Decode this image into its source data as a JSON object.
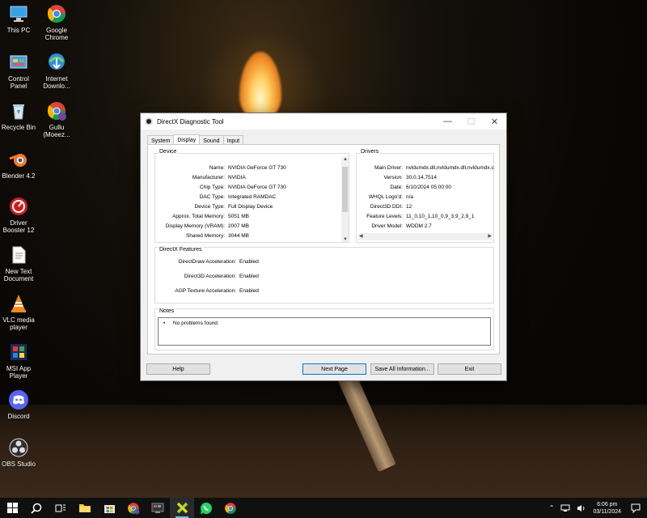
{
  "desktop": {
    "icons": [
      {
        "label": "This PC",
        "icon": "this-pc-icon"
      },
      {
        "label": "Google\nChrome",
        "icon": "chrome-icon"
      },
      {
        "label": "Control\nPanel",
        "icon": "control-panel-icon"
      },
      {
        "label": "Internet\nDownlo...",
        "icon": "idm-icon"
      },
      {
        "label": "Recycle Bin",
        "icon": "recycle-bin-icon"
      },
      {
        "label": "Gullu\n(Moeez...",
        "icon": "chrome-profile-icon"
      },
      {
        "label": "Blender 4.2",
        "icon": "blender-icon"
      },
      {
        "label": "Driver\nBooster 12",
        "icon": "driver-booster-icon"
      },
      {
        "label": "New Text\nDocument",
        "icon": "text-document-icon"
      },
      {
        "label": "VLC media\nplayer",
        "icon": "vlc-icon"
      },
      {
        "label": "MSI App\nPlayer",
        "icon": "msi-app-player-icon"
      },
      {
        "label": "Discord",
        "icon": "discord-icon"
      },
      {
        "label": "OBS Studio",
        "icon": "obs-icon"
      }
    ]
  },
  "window": {
    "title": "DirectX Diagnostic Tool",
    "controls": {
      "minimize": "—",
      "maximize": "☐",
      "close": "✕"
    },
    "tabs": [
      "System",
      "Display",
      "Sound",
      "Input"
    ],
    "active_tab": "Display",
    "device": {
      "title": "Device",
      "rows": [
        {
          "k": "Name:",
          "v": "NVIDIA GeForce GT 730"
        },
        {
          "k": "Manufacturer:",
          "v": "NVIDIA"
        },
        {
          "k": "Chip Type:",
          "v": "NVIDIA GeForce GT 730"
        },
        {
          "k": "DAC Type:",
          "v": "Integrated RAMDAC"
        },
        {
          "k": "Device Type:",
          "v": "Full Display Device"
        },
        {
          "k": "Approx. Total Memory:",
          "v": "5051 MB"
        },
        {
          "k": "Display Memory (VRAM):",
          "v": "2007 MB"
        },
        {
          "k": "Shared Memory:",
          "v": "3044 MB"
        }
      ]
    },
    "drivers": {
      "title": "Drivers",
      "rows": [
        {
          "k": "Main Driver:",
          "v": "nvldumdx.dll,nvldumdx.dll,nvldumdx.c"
        },
        {
          "k": "Version:",
          "v": "30.0.14.7514"
        },
        {
          "k": "Date:",
          "v": "6/10/2024 05:00:00"
        },
        {
          "k": "WHQL Logo'd:",
          "v": "n/a"
        },
        {
          "k": "Direct3D DDI:",
          "v": "12"
        },
        {
          "k": "Feature Levels:",
          "v": "11_0,10_1,10_0,9_3,9_2,9_1"
        },
        {
          "k": "Driver Model:",
          "v": "WDDM 2.7"
        }
      ]
    },
    "features": {
      "title": "DirectX Features",
      "rows": [
        {
          "k": "DirectDraw Acceleration:",
          "v": "Enabled"
        },
        {
          "k": "Direct3D Acceleration:",
          "v": "Enabled"
        },
        {
          "k": "AGP Texture Acceleration:",
          "v": "Enabled"
        }
      ]
    },
    "notes": {
      "title": "Notes",
      "bullet": "•",
      "text": "No problems found."
    },
    "buttons": {
      "help": "Help",
      "next": "Next Page",
      "save": "Save All Information...",
      "exit": "Exit"
    }
  },
  "taskbar": {
    "clock_time": "6:06 pm",
    "clock_date": "03/11/2024"
  }
}
